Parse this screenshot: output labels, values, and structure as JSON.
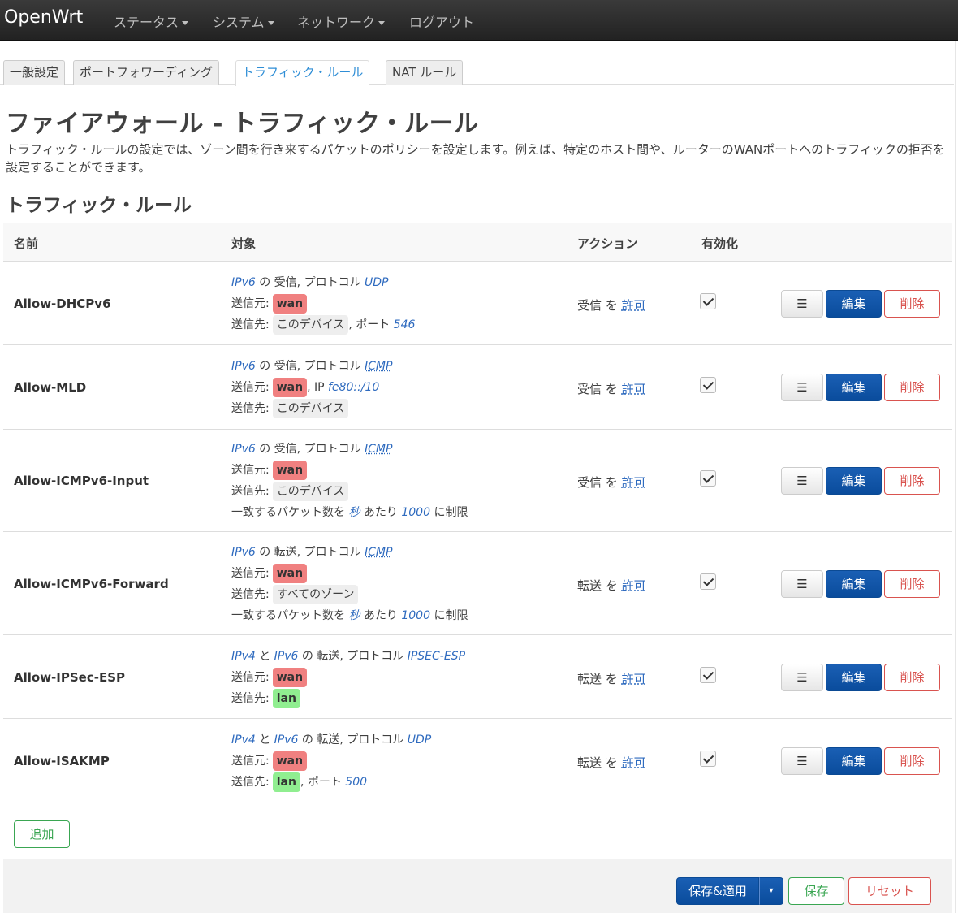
{
  "navbar": {
    "brand": "OpenWrt",
    "items": [
      "ステータス",
      "システム",
      "ネットワーク",
      "ログアウト"
    ]
  },
  "tabs": [
    "一般設定",
    "ポートフォワーディング",
    "トラフィック・ルール",
    "NAT ルール"
  ],
  "active_tab": "トラフィック・ルール",
  "page": {
    "title": "ファイアウォール - トラフィック・ルール",
    "description": "トラフィック・ルールの設定では、ゾーン間を行き来するパケットのポリシーを設定します。例えば、特定のホスト間や、ルーターのWANポートへのトラフィックの拒否を設定することができます。",
    "section_title": "トラフィック・ルール"
  },
  "table": {
    "headers": [
      "名前",
      "対象",
      "アクション",
      "有効化"
    ],
    "rows": [
      {
        "name": "Allow-DHCPv6",
        "m1": {
          "family_a": "IPv6",
          "sep": "",
          "family_b": "",
          "post": " の 受信, プロトコル ",
          "proto": "UDP"
        },
        "src_label": "送信元:",
        "src_zone": "wan",
        "src_extra_pre": "",
        "src_extra_val": "",
        "dst_label": "送信先:",
        "dst_zone": "このデバイス",
        "dst_extra_pre": ", ポート ",
        "dst_extra_val": "546",
        "limit": "",
        "action": "受信",
        "action_mid": " を ",
        "action_verdict": "許可",
        "enabled": true
      },
      {
        "name": "Allow-MLD",
        "m1": {
          "family_a": "IPv6",
          "sep": "",
          "family_b": "",
          "post": " の 受信, プロトコル ",
          "proto": "ICMP"
        },
        "src_label": "送信元:",
        "src_zone": "wan",
        "src_extra_pre": ", IP ",
        "src_extra_val": "fe80::/10",
        "dst_label": "送信先:",
        "dst_zone": "このデバイス",
        "dst_extra_pre": "",
        "dst_extra_val": "",
        "limit": "",
        "action": "受信",
        "action_mid": " を ",
        "action_verdict": "許可",
        "enabled": true
      },
      {
        "name": "Allow-ICMPv6-Input",
        "m1": {
          "family_a": "IPv6",
          "sep": "",
          "family_b": "",
          "post": " の 受信, プロトコル ",
          "proto": "ICMP"
        },
        "src_label": "送信元:",
        "src_zone": "wan",
        "src_extra_pre": "",
        "src_extra_val": "",
        "dst_label": "送信先:",
        "dst_zone": "このデバイス",
        "dst_extra_pre": "",
        "dst_extra_val": "",
        "limit": {
          "pre": "一致するパケット数を ",
          "unit": "秒",
          "mid": " あたり ",
          "value": "1000",
          "post": " に制限"
        },
        "action": "受信",
        "action_mid": " を ",
        "action_verdict": "許可",
        "enabled": true
      },
      {
        "name": "Allow-ICMPv6-Forward",
        "m1": {
          "family_a": "IPv6",
          "sep": "",
          "family_b": "",
          "post": " の 転送, プロトコル ",
          "proto": "ICMP"
        },
        "src_label": "送信元:",
        "src_zone": "wan",
        "src_extra_pre": "",
        "src_extra_val": "",
        "dst_label": "送信先:",
        "dst_zone": "すべてのゾーン",
        "dst_extra_pre": "",
        "dst_extra_val": "",
        "limit": {
          "pre": "一致するパケット数を ",
          "unit": "秒",
          "mid": " あたり ",
          "value": "1000",
          "post": " に制限"
        },
        "action": "転送",
        "action_mid": " を ",
        "action_verdict": "許可",
        "enabled": true
      },
      {
        "name": "Allow-IPSec-ESP",
        "m1": {
          "family_a": "IPv4",
          "sep": " と ",
          "family_b": "IPv6",
          "post": " の 転送, プロトコル ",
          "proto": "IPSEC-ESP"
        },
        "src_label": "送信元:",
        "src_zone": "wan",
        "src_extra_pre": "",
        "src_extra_val": "",
        "dst_label": "送信先:",
        "dst_zone": "lan",
        "dst_extra_pre": "",
        "dst_extra_val": "",
        "limit": "",
        "action": "転送",
        "action_mid": " を ",
        "action_verdict": "許可",
        "enabled": true
      },
      {
        "name": "Allow-ISAKMP",
        "m1": {
          "family_a": "IPv4",
          "sep": " と ",
          "family_b": "IPv6",
          "post": " の 転送, プロトコル ",
          "proto": "UDP"
        },
        "src_label": "送信元:",
        "src_zone": "wan",
        "src_extra_pre": "",
        "src_extra_val": "",
        "dst_label": "送信先:",
        "dst_zone": "lan",
        "dst_extra_pre": ", ポート ",
        "dst_extra_val": "500",
        "limit": "",
        "action": "転送",
        "action_mid": " を ",
        "action_verdict": "許可",
        "enabled": true
      }
    ],
    "row_buttons": {
      "menu": "☰",
      "edit": "編集",
      "delete": "削除"
    }
  },
  "add_button": "追加",
  "footer": {
    "apply": "保存&適用",
    "apply_dropdown": "▾",
    "save": "保存",
    "reset": "リセット"
  },
  "colors": {
    "wan_zone": "#f08080",
    "lan_zone": "#90ee90",
    "primary": "#0a4c9c",
    "danger": "#d9534f",
    "success": "#3aa652",
    "link": "#2f6bbf"
  }
}
